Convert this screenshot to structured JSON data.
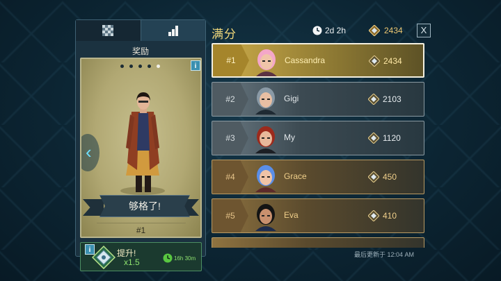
{
  "tabs": [
    {
      "name": "checker-icon",
      "active": false
    },
    {
      "name": "bar-chart-icon",
      "active": true
    }
  ],
  "reward": {
    "title": "奖励",
    "carousel_dots": 5,
    "carousel_active": 5,
    "banner_text": "够格了!",
    "rank_text": "#1"
  },
  "boost": {
    "label": "提升!",
    "multiplier": "x1.5",
    "time_left": "16h 30m"
  },
  "header": {
    "title": "满分",
    "timer": "2d 2h",
    "score": "2434",
    "close_label": "X"
  },
  "leaderboard": [
    {
      "rank": "#1",
      "name": "Cassandra",
      "score": "2434",
      "tier": "first",
      "hair": "#f4a7c8",
      "skin": "#f0c4a8",
      "shirt": "#5b3242"
    },
    {
      "rank": "#2",
      "name": "Gigi",
      "score": "2103",
      "tier": "silver",
      "hair": "#8a9aa6",
      "skin": "#e8bfa3",
      "shirt": "#1f2a33"
    },
    {
      "rank": "#3",
      "name": "My",
      "score": "1120",
      "tier": "silver",
      "hair": "#9c2a1c",
      "skin": "#e7b89b",
      "shirt": "#1c1f24"
    },
    {
      "rank": "#4",
      "name": "Grace",
      "score": "450",
      "tier": "bronze",
      "hair": "#5a8ee8",
      "skin": "#efc3a6",
      "shirt": "#5d2a2a"
    },
    {
      "rank": "#5",
      "name": "Eva",
      "score": "410",
      "tier": "bronze",
      "hair": "#141414",
      "skin": "#c9906e",
      "shirt": "#1d2b4c"
    }
  ],
  "footer": {
    "updated": "最后更新于 12:04 AM"
  },
  "colors": {
    "gold_accent": "#f1d87a",
    "boost_green": "#8fe36f",
    "info_blue": "#3b90b0"
  }
}
